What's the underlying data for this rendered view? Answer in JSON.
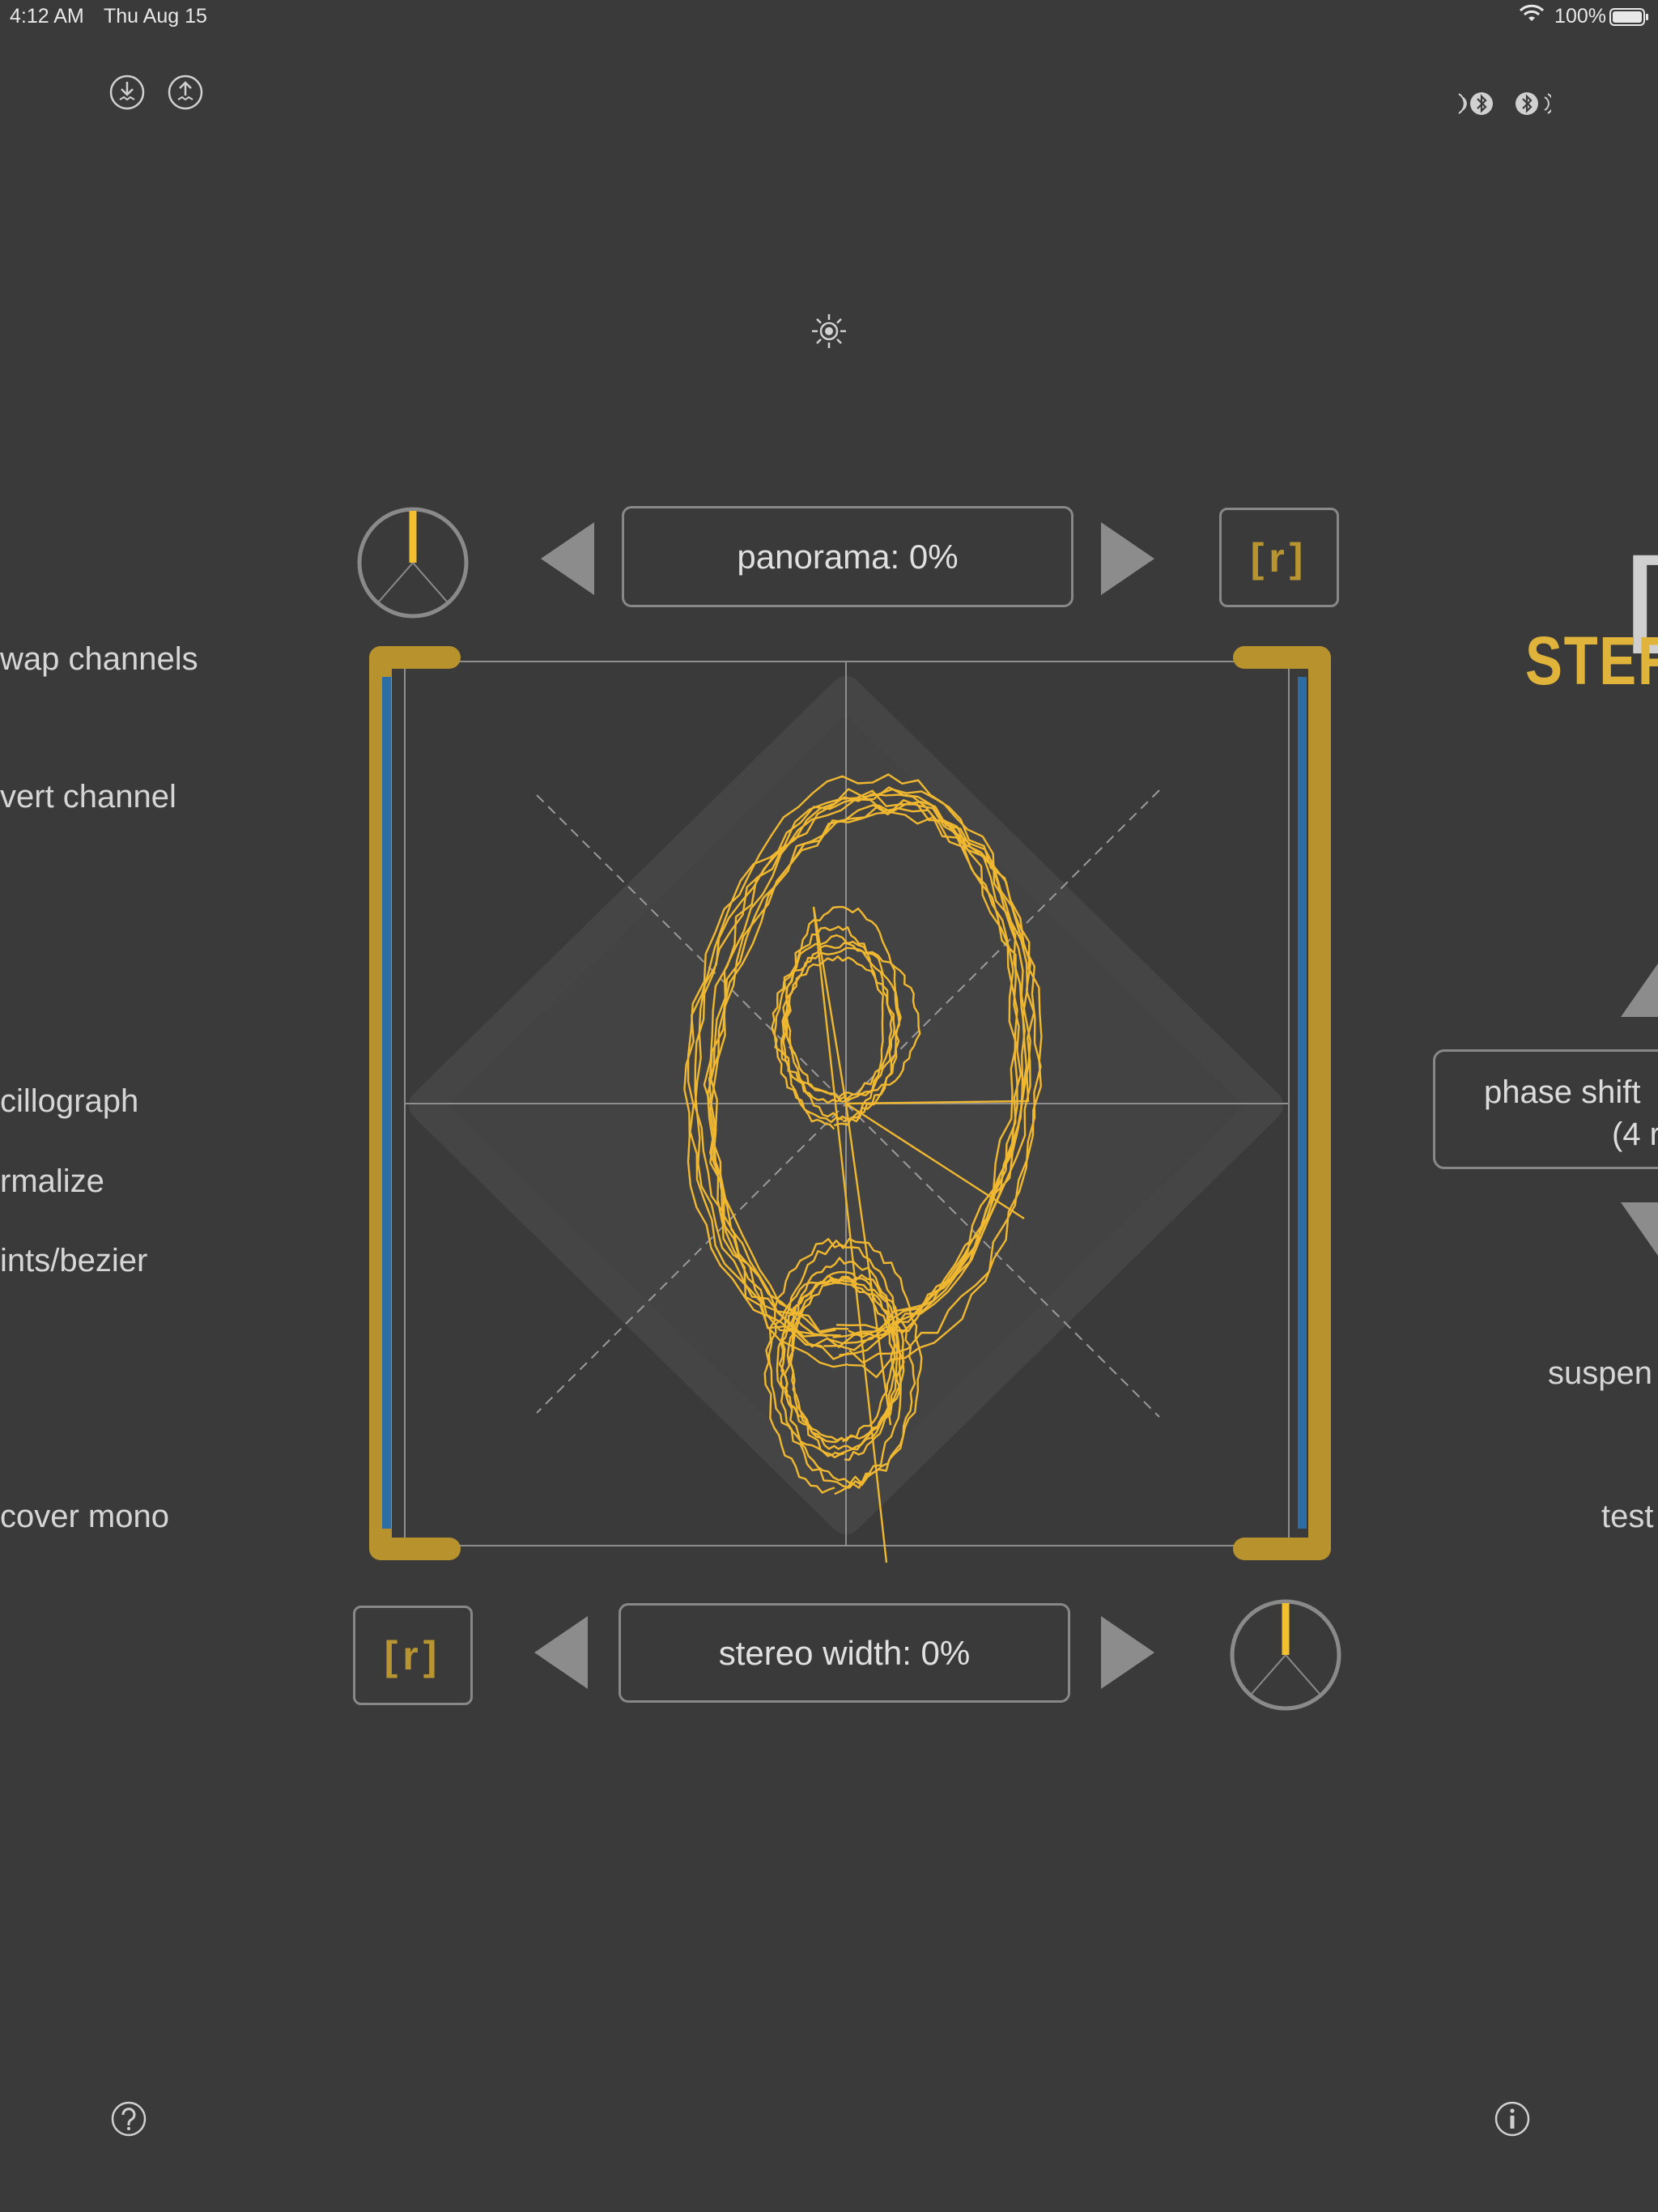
{
  "status_bar": {
    "time": "4:12 AM",
    "date": "Thu Aug 15",
    "battery_percent": "100%"
  },
  "toolbar": {
    "import_icon": "import-icon",
    "export_icon": "export-icon",
    "bluetooth_in_icon": "bluetooth-input-icon",
    "bluetooth_out_icon": "bluetooth-output-icon",
    "brightness_icon": "brightness-icon"
  },
  "left_menu": {
    "swap_channels": "wap channels",
    "invert_channel": "vert channel",
    "oscillograph": "cillograph",
    "normalize": "rmalize",
    "points_bezier": "ints/bezier",
    "recover_mono": "cover mono"
  },
  "top_controls": {
    "panorama_label": "panorama: 0%",
    "panorama_knob_value": 0,
    "reset_label": "[r]"
  },
  "bottom_controls": {
    "stereo_width_label": "stereo width: 0%",
    "stereo_width_knob_value": 0,
    "reset_label": "[r]"
  },
  "right_panel": {
    "title_bracket": "[",
    "title": "STER",
    "phase_shift_line1": "phase shift",
    "phase_shift_line2": "(4 r",
    "suspend_label": "suspen",
    "test_label": "test"
  },
  "footer": {
    "help_icon": "help-icon",
    "info_icon": "info-icon"
  },
  "colors": {
    "background": "#3a3a3a",
    "accent_gold": "#f0b830",
    "meter_blue": "#2c6ea3",
    "frame_gold": "#b8922c"
  }
}
